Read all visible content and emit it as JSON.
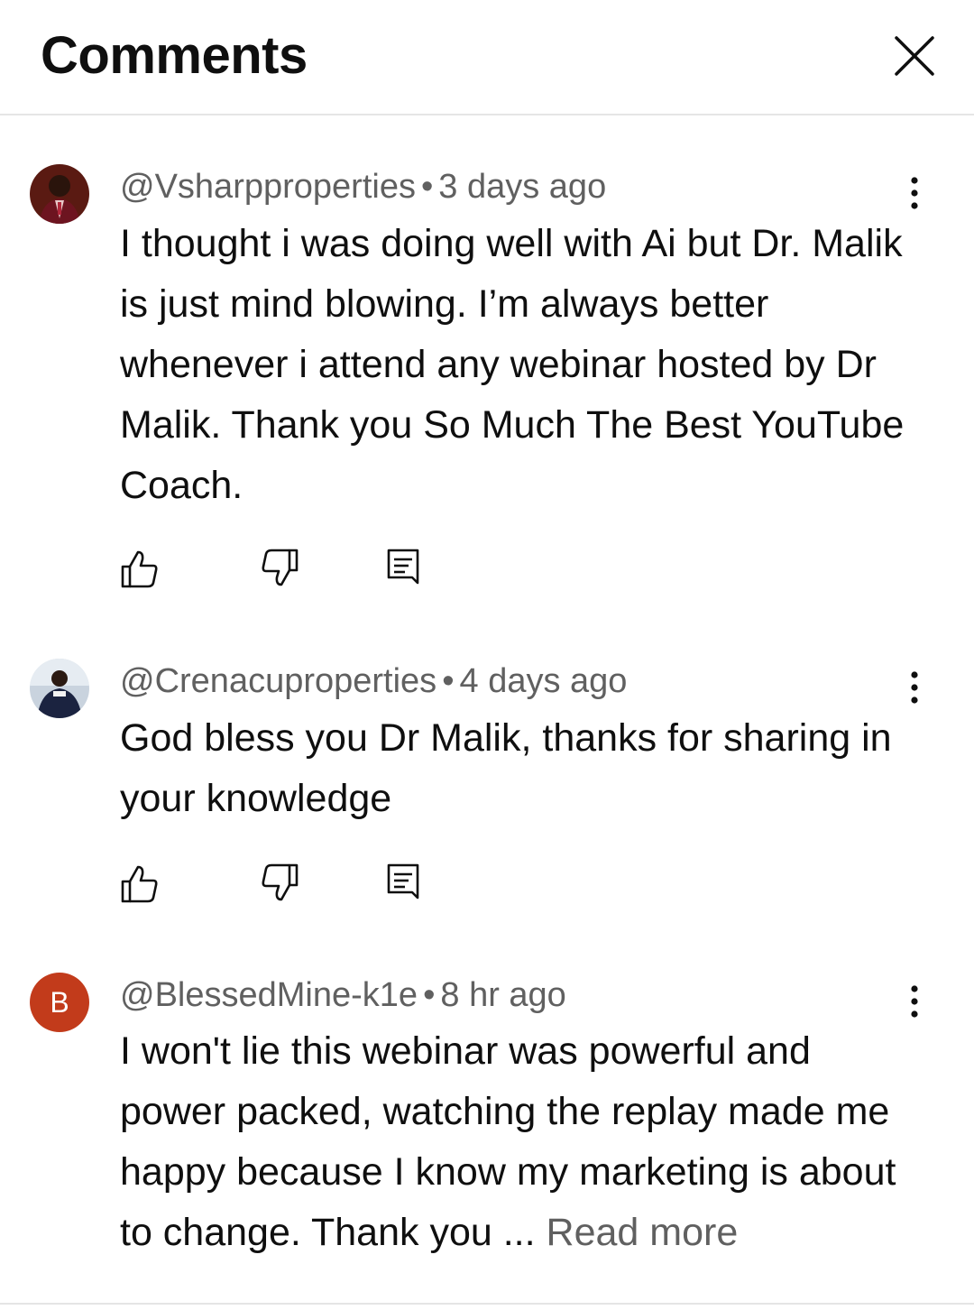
{
  "header": {
    "title": "Comments",
    "close_icon": "close-icon"
  },
  "comments": [
    {
      "handle": "@Vsharpproperties",
      "separator": "•",
      "time": "3 days ago",
      "text": "I thought i was doing well with Ai but Dr. Malik is just mind blowing. I’m always better whenever i attend any webinar hosted by Dr Malik. Thank you So Much The Best YouTube Coach.",
      "avatar": "profile-photo"
    },
    {
      "handle": "@Crenacuproperties",
      "separator": "•",
      "time": "4 days ago",
      "text": "God bless you Dr Malik, thanks for sharing in your knowledge",
      "avatar": "profile-photo"
    },
    {
      "handle": "@BlessedMine-k1e",
      "separator": "•",
      "time": "8 hr ago",
      "text": "I won't lie this webinar was powerful and power packed, watching the replay made me happy because I know my marketing is about to change. Thank you ...",
      "read_more": "Read more",
      "avatar_letter": "B",
      "avatar_color": "#c23b1b"
    }
  ],
  "icons": {
    "like": "thumbs-up-icon",
    "dislike": "thumbs-down-icon",
    "reply": "reply-icon",
    "more": "more-vertical-icon"
  },
  "colors": {
    "text": "#0f0f0f",
    "meta": "#606060",
    "divider": "#e5e5e5"
  }
}
